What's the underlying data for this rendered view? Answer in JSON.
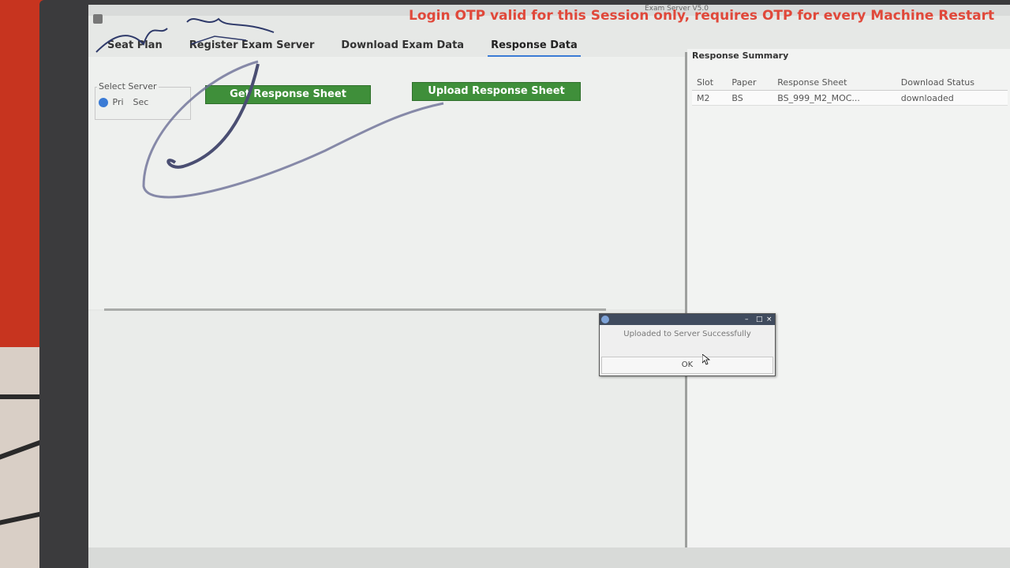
{
  "window": {
    "title": "Exam Server V5.0"
  },
  "banner": {
    "text": "Login OTP valid for this Session only, requires OTP for every Machine Restart",
    "color": "#e0483a"
  },
  "tabs": [
    {
      "label": "Seat Plan",
      "active": false
    },
    {
      "label": "Register Exam Server",
      "active": false
    },
    {
      "label": "Download Exam Data",
      "active": false
    },
    {
      "label": "Response Data",
      "active": true
    }
  ],
  "server_select": {
    "legend": "Select Server",
    "options": [
      {
        "label": "Pri",
        "selected": true
      },
      {
        "label": "Sec",
        "selected": false
      }
    ]
  },
  "actions": {
    "get_response": "Get Response Sheet",
    "upload_response": "Upload Response Sheet",
    "button_color": "#3f8f3a"
  },
  "summary": {
    "title": "Response Summary",
    "columns": [
      "Slot",
      "Paper",
      "Response Sheet",
      "Download Status"
    ],
    "rows": [
      [
        "M2",
        "BS",
        "BS_999_M2_MOC...",
        "downloaded"
      ]
    ]
  },
  "dialog": {
    "message": "Uploaded to Server Successfully",
    "ok_label": "OK"
  }
}
